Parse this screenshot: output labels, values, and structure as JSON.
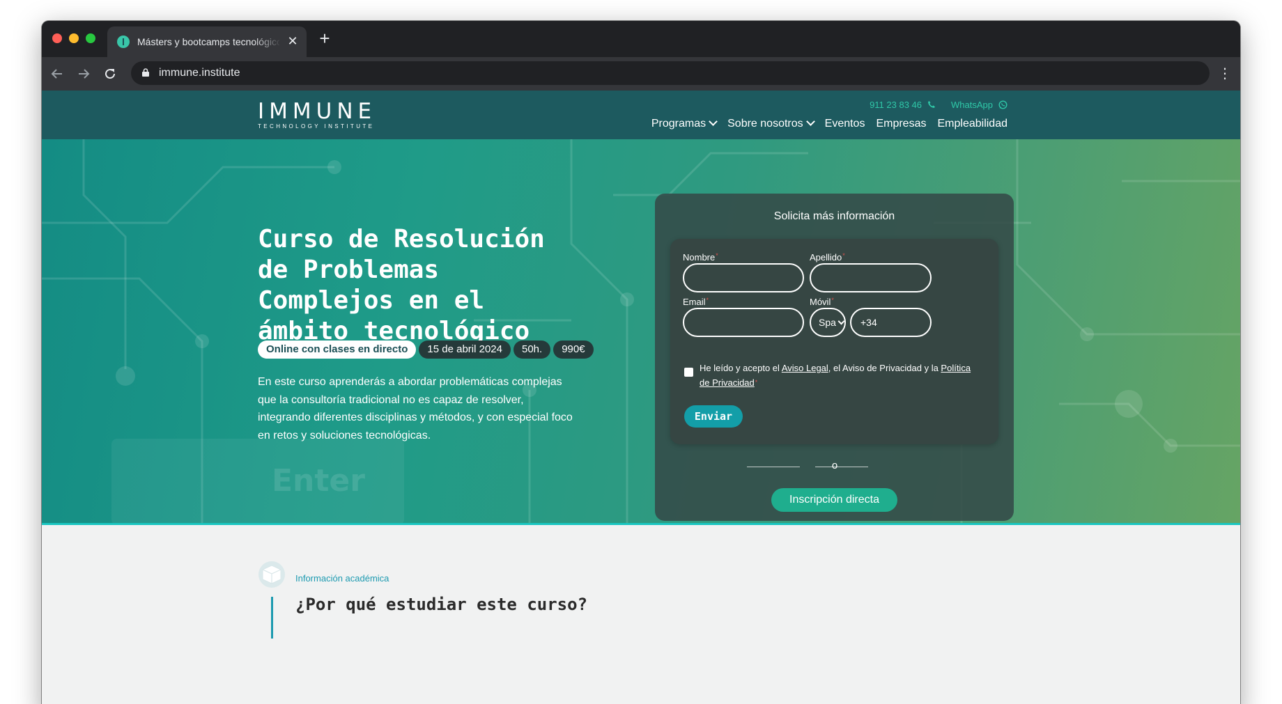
{
  "browser": {
    "tab_title": "Másters y bootcamps tecnológicos",
    "tab_close": "✕",
    "new_tab": "+",
    "url": "immune.institute",
    "menu": "⋮"
  },
  "site": {
    "logo": {
      "word": "IMMUNE",
      "sub": "TECHNOLOGY INSTITUTE"
    },
    "contact": {
      "phone": "911 23 83 46",
      "whatsapp": "WhatsApp"
    },
    "nav": [
      {
        "label": "Programas",
        "has_menu": true
      },
      {
        "label": "Sobre nosotros",
        "has_menu": true
      },
      {
        "label": "Eventos",
        "has_menu": false
      },
      {
        "label": "Empresas",
        "has_menu": false
      },
      {
        "label": "Empleabilidad",
        "has_menu": false
      }
    ]
  },
  "hero": {
    "title": "Curso de Resolución de Problemas Complejos en el ámbito tecnológico",
    "badges": {
      "mode": "Online con clases en directo",
      "date": "15 de abril 2024",
      "hours": "50h.",
      "price": "990€"
    },
    "description": "En este curso aprenderás a abordar problemáticas complejas que la consultoría tradicional no es capaz de resolver, integrando diferentes disciplinas y métodos, y con especial foco en retos y soluciones tecnológicas.",
    "background_watermark": "Enter"
  },
  "form": {
    "heading": "Solicita más información",
    "fields": {
      "first_name": {
        "label": "Nombre",
        "value": ""
      },
      "last_name": {
        "label": "Apellido",
        "value": ""
      },
      "email": {
        "label": "Email",
        "value": ""
      },
      "phone": {
        "label": "Móvil",
        "country": "Spa",
        "prefix": "+34"
      }
    },
    "required_mark": "*",
    "consent": {
      "prefix": "He leído y acepto el ",
      "legal": "Aviso Legal",
      "middle": ", el Aviso de Privacidad y la ",
      "privacy": "Política de Privacidad",
      "checked": false
    },
    "submit": "Enviar",
    "or": "o",
    "direct": "Inscripción directa"
  },
  "section": {
    "kicker": "Información académica",
    "title": "¿Por qué estudiar este curso?"
  },
  "colors": {
    "header": "#1d5a5f",
    "accent_teal": "#2fc8a8",
    "button_blue": "#139ea8",
    "button_green": "#1fae8e",
    "kicker": "#1c9ab0"
  },
  "icons": {
    "back": "arrow-left-icon",
    "forward": "arrow-right-icon",
    "reload": "reload-icon",
    "lock": "lock-icon",
    "phone": "phone-icon",
    "whatsapp": "whatsapp-icon",
    "cube": "cube-icon"
  }
}
